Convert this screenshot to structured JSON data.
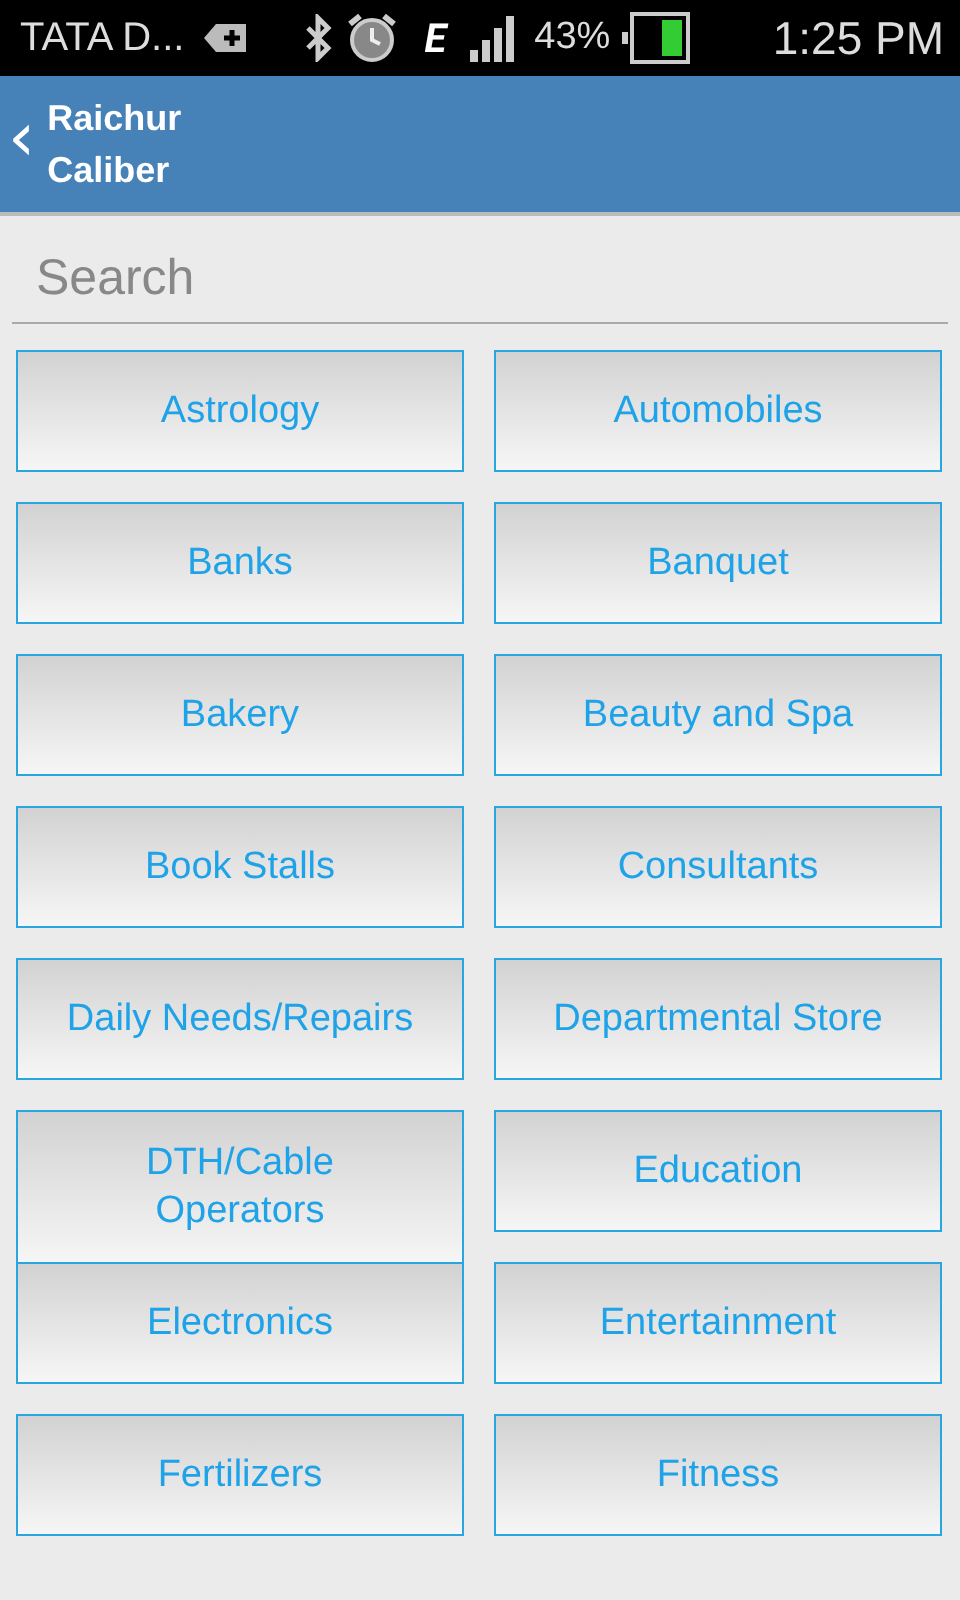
{
  "status_bar": {
    "carrier": "TATA D...",
    "network_type": "E",
    "battery": "43%",
    "time": "1:25 PM"
  },
  "action_bar": {
    "back": "‹",
    "title": "Raichur\nCaliber"
  },
  "search": {
    "placeholder": "Search"
  },
  "categories": [
    {
      "label": "Astrology"
    },
    {
      "label": "Automobiles"
    },
    {
      "label": "Banks"
    },
    {
      "label": "Banquet"
    },
    {
      "label": "Bakery"
    },
    {
      "label": "Beauty and Spa"
    },
    {
      "label": "Book Stalls"
    },
    {
      "label": "Consultants"
    },
    {
      "label": "Daily Needs/Repairs"
    },
    {
      "label": "Departmental Store"
    },
    {
      "label": "DTH/Cable\nOperators"
    },
    {
      "label": "Education"
    },
    {
      "label": "Electronics"
    },
    {
      "label": "Entertainment"
    },
    {
      "label": "Fertilizers"
    },
    {
      "label": "Fitness"
    }
  ]
}
